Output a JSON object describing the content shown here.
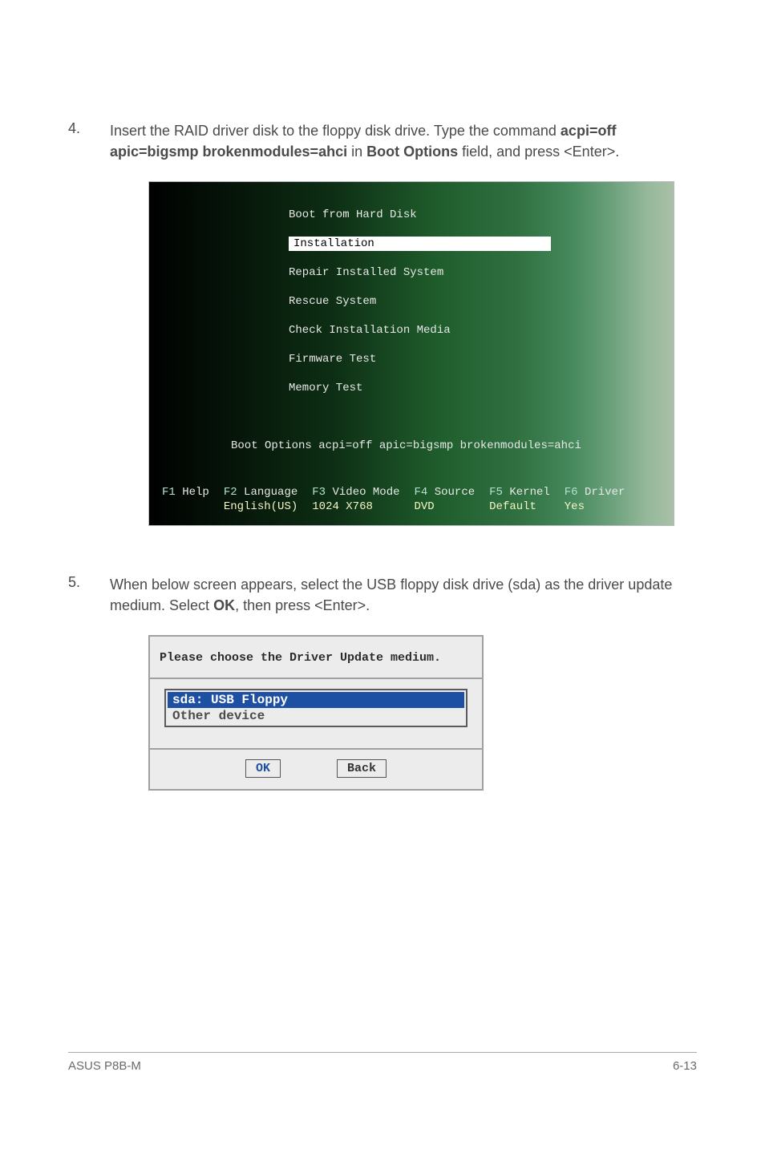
{
  "step4": {
    "num": "4.",
    "pre": "Insert the RAID driver disk to the floppy disk drive. Type the command ",
    "bold1": "acpi=off apic=bigsmp brokenmodules=ahci",
    "mid": " in ",
    "bold2": "Boot Options",
    "post": " field, and press <Enter>."
  },
  "boot": {
    "m0": "Boot from Hard Disk",
    "m1": "Installation",
    "m2": "Repair Installed System",
    "m3": "Rescue System",
    "m4": "Check Installation Media",
    "m5": "Firmware Test",
    "m6": "Memory Test",
    "opts": "Boot Options acpi=off apic=bigsmp brokenmodules=ahci",
    "f1a": "F1",
    "f1b": "Help",
    "f2a": "F2",
    "f2b": "Language",
    "f2s": "English(US)",
    "f3a": "F3",
    "f3b": "Video Mode",
    "f3s": "1024 X768",
    "f4a": "F4",
    "f4b": "Source",
    "f4s": "DVD",
    "f5a": "F5",
    "f5b": "Kernel",
    "f5s": "Default",
    "f6a": "F6",
    "f6b": "Driver",
    "f6s": "Yes"
  },
  "step5": {
    "num": "5.",
    "pre": "When below screen appears, select the USB floppy disk drive (sda) as the driver update medium. Select ",
    "bold1": "OK",
    "post": ", then press <Enter>."
  },
  "dlg": {
    "title": "Please choose the Driver Update medium.",
    "item1": "sda: USB Floppy",
    "item2": "Other device",
    "ok": "OK",
    "back": "Back"
  },
  "footer": {
    "left": "ASUS P8B-M",
    "right": "6-13"
  }
}
